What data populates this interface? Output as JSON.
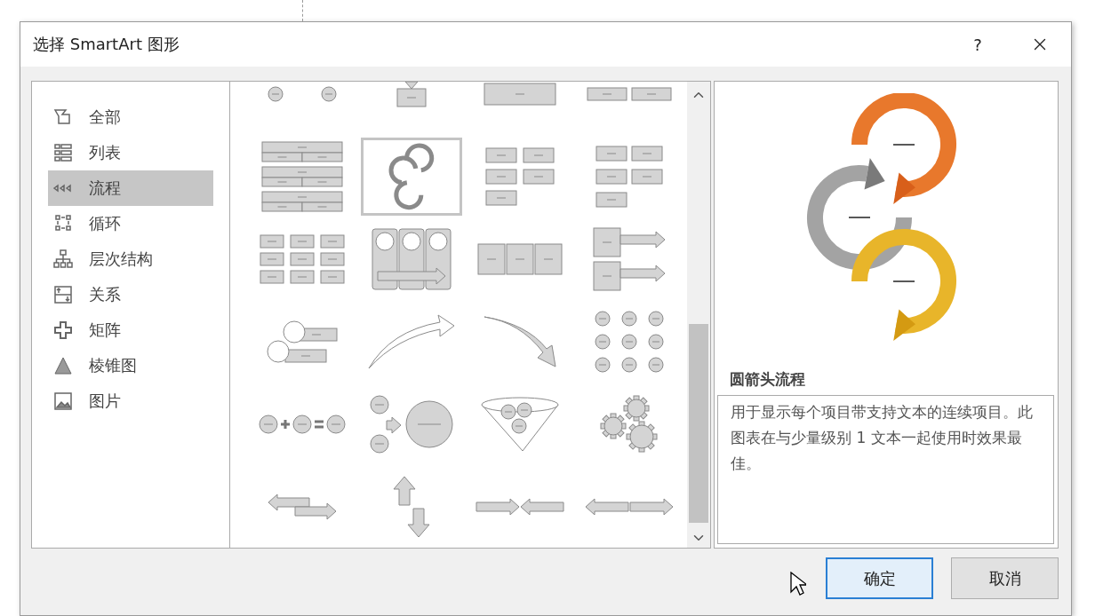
{
  "dialog": {
    "title": "选择 SmartArt 图形",
    "help": "?"
  },
  "categories": [
    {
      "label": "全部",
      "selected": false
    },
    {
      "label": "列表",
      "selected": false
    },
    {
      "label": "流程",
      "selected": true
    },
    {
      "label": "循环",
      "selected": false
    },
    {
      "label": "层次结构",
      "selected": false
    },
    {
      "label": "关系",
      "selected": false
    },
    {
      "label": "矩阵",
      "selected": false
    },
    {
      "label": "棱锥图",
      "selected": false
    },
    {
      "label": "图片",
      "selected": false
    }
  ],
  "gallery": [
    {
      "kind": "dots",
      "selected": false
    },
    {
      "kind": "dropbox",
      "selected": false
    },
    {
      "kind": "wide",
      "selected": false
    },
    {
      "kind": "twin",
      "selected": false
    },
    {
      "kind": "stacked",
      "selected": false
    },
    {
      "kind": "cycle",
      "selected": true
    },
    {
      "kind": "zigzag",
      "selected": false
    },
    {
      "kind": "steps",
      "selected": false
    },
    {
      "kind": "snake",
      "selected": false
    },
    {
      "kind": "columns",
      "selected": false
    },
    {
      "kind": "chevrons",
      "selected": false
    },
    {
      "kind": "arrowlist",
      "selected": false
    },
    {
      "kind": "bubbles",
      "selected": false
    },
    {
      "kind": "rise",
      "selected": false
    },
    {
      "kind": "fall",
      "selected": false
    },
    {
      "kind": "circlegrid",
      "selected": false
    },
    {
      "kind": "equation",
      "selected": false
    },
    {
      "kind": "plus",
      "selected": false
    },
    {
      "kind": "funnel",
      "selected": false
    },
    {
      "kind": "gears",
      "selected": false
    },
    {
      "kind": "apart",
      "selected": false
    },
    {
      "kind": "updown",
      "selected": false
    },
    {
      "kind": "converge",
      "selected": false
    },
    {
      "kind": "diverge",
      "selected": false
    }
  ],
  "preview": {
    "name": "圆箭头流程",
    "description": "用于显示每个项目带支持文本的连续项目。此图表在与少量级别 1 文本一起使用时效果最佳。"
  },
  "buttons": [
    {
      "label": "确定",
      "kind": "primary"
    },
    {
      "label": "取消",
      "kind": "secondary"
    }
  ]
}
